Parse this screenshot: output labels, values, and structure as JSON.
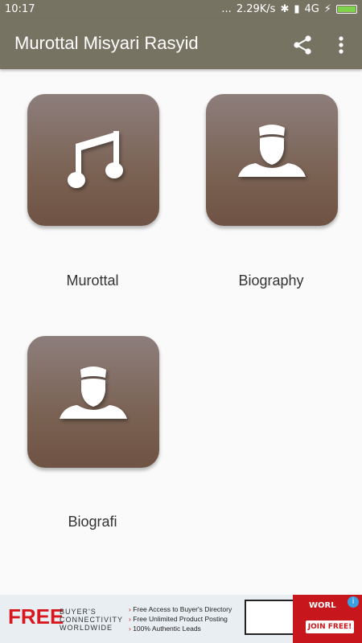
{
  "status_bar": {
    "time": "10:17",
    "speed": "2.29K/s",
    "network": "4G"
  },
  "app_bar": {
    "title": "Murottal Misyari Rasyid",
    "icons": [
      "share-icon",
      "more-vert-icon"
    ]
  },
  "tiles": [
    {
      "label": "Murottal",
      "icon": "music-note-icon"
    },
    {
      "label": "Biography",
      "icon": "person-cap-icon"
    },
    {
      "label": "Biografi",
      "icon": "person-cap-icon"
    }
  ],
  "ad": {
    "free": "FREE",
    "brand_line1": "BUYER'S",
    "brand_line2": "CONNECTIVITY",
    "brand_line3": "WORLDWIDE",
    "bullet1": "Free Access to Buyer's Directory",
    "bullet2": "Free Unlimited Product Posting",
    "bullet3": "100% Authentic Leads",
    "promo_brand": "WORL",
    "cta": "JOIN FREE!",
    "info": "i"
  },
  "colors": {
    "app_bar": "#777363",
    "tile_top": "#8d7e7c",
    "tile_bottom": "#6f5344",
    "background": "#fafafa"
  }
}
